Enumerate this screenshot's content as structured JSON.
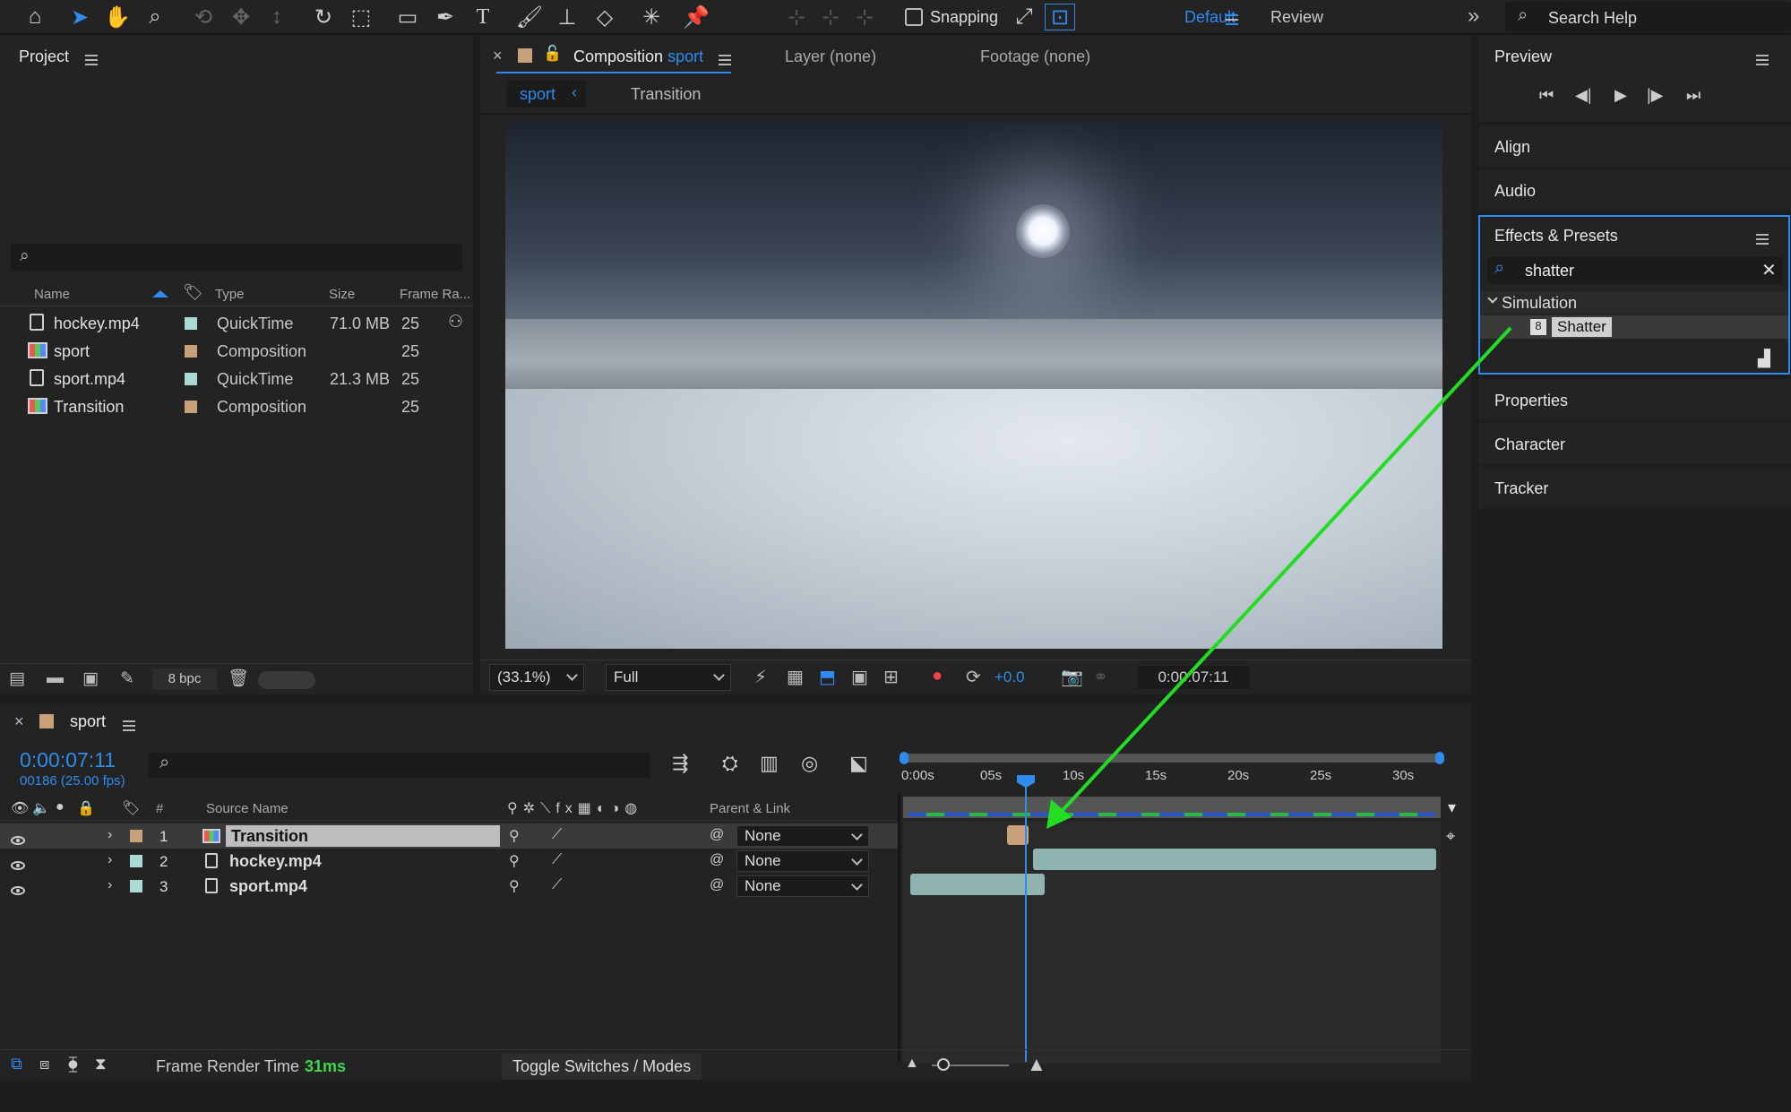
{
  "toolbar": {
    "snapping_label": "Snapping",
    "workspace_default": "Default",
    "workspace_review": "Review",
    "search_help": "Search Help"
  },
  "project": {
    "title": "Project",
    "columns": {
      "name": "Name",
      "type": "Type",
      "size": "Size",
      "frame_rate": "Frame Ra..."
    },
    "items": [
      {
        "name": "hockey.mp4",
        "type": "QuickTime",
        "size": "71.0 MB",
        "fps": "25",
        "swatch": "#a9dad4"
      },
      {
        "name": "sport",
        "type": "Composition",
        "size": "",
        "fps": "25",
        "swatch": "#c8a07a"
      },
      {
        "name": "sport.mp4",
        "type": "QuickTime",
        "size": "21.3 MB",
        "fps": "25",
        "swatch": "#a9dad4"
      },
      {
        "name": "Transition",
        "type": "Composition",
        "size": "",
        "fps": "25",
        "swatch": "#c8a07a"
      }
    ],
    "bpc": "8 bpc"
  },
  "composition": {
    "tab_prefix": "Composition",
    "tab_name": "sport",
    "layer_tab": "Layer (none)",
    "footage_tab": "Footage (none)",
    "crumb_active": "sport",
    "crumb_other": "Transition",
    "zoom": "(33.1%)",
    "resolution": "Full",
    "exposure": "+0.0",
    "timecode": "0:00:07:11"
  },
  "right_panels": {
    "preview": "Preview",
    "align": "Align",
    "audio": "Audio",
    "effects_title": "Effects & Presets",
    "search_value": "shatter",
    "category": "Simulation",
    "effect": "Shatter",
    "properties": "Properties",
    "character": "Character",
    "tracker": "Tracker"
  },
  "timeline": {
    "comp_name": "sport",
    "timecode": "0:00:07:11",
    "frames": "00186 (25.00 fps)",
    "col_hash": "#",
    "col_source": "Source Name",
    "col_parent": "Parent & Link",
    "ruler": [
      "0:00s",
      "05s",
      "10s",
      "15s",
      "20s",
      "25s",
      "30s"
    ],
    "layers": [
      {
        "num": "1",
        "name": "Transition",
        "parent": "None",
        "swatch": "#c8a07a"
      },
      {
        "num": "2",
        "name": "hockey.mp4",
        "parent": "None",
        "swatch": "#a9dad4"
      },
      {
        "num": "3",
        "name": "sport.mp4",
        "parent": "None",
        "swatch": "#a9dad4"
      }
    ],
    "status_label": "Frame Render Time",
    "status_value": "31ms",
    "toggle_label": "Toggle Switches / Modes"
  },
  "colors": {
    "accent": "#2f8bf0",
    "arrow": "#22dd22",
    "status_green": "#3ed84c"
  }
}
